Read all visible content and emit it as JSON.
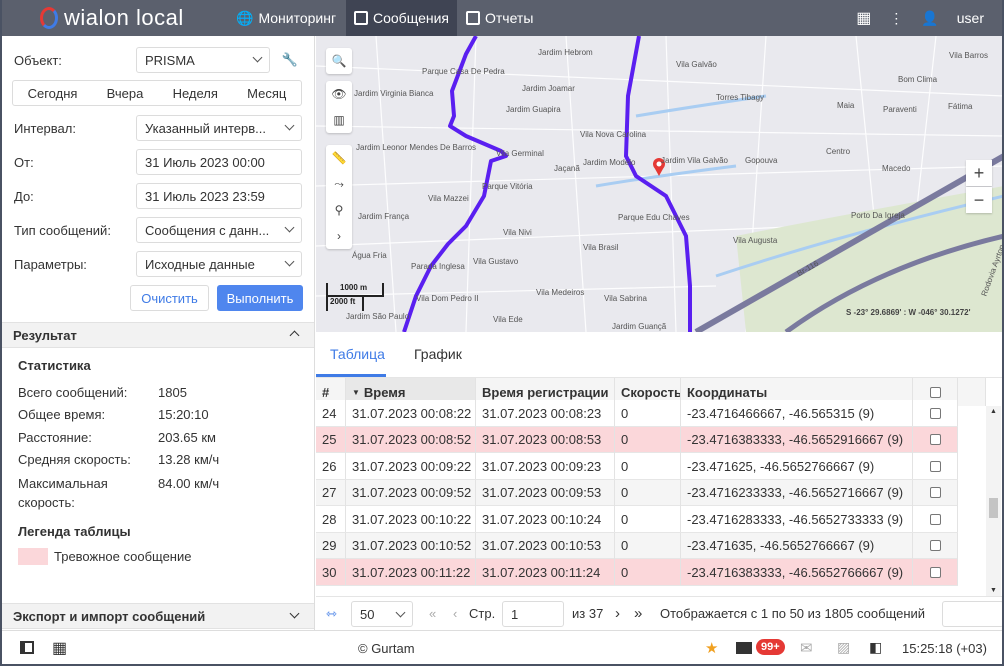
{
  "app": {
    "logo": "wialon local",
    "nav": [
      "Мониторинг",
      "Сообщения",
      "Отчеты"
    ],
    "active_nav": "Сообщения",
    "user": "user"
  },
  "form": {
    "object_label": "Объект:",
    "object_value": "PRISMA",
    "quick": [
      "Сегодня",
      "Вчера",
      "Неделя",
      "Месяц"
    ],
    "interval_label": "Интервал:",
    "interval_value": "Указанный интерв...",
    "from_label": "От:",
    "from_value": "31 Июль 2023 00:00",
    "to_label": "До:",
    "to_value": "31 Июль 2023 23:59",
    "type_label": "Тип сообщений:",
    "type_value": "Сообщения с данн...",
    "params_label": "Параметры:",
    "params_value": "Исходные данные",
    "clear": "Очистить",
    "execute": "Выполнить"
  },
  "result": {
    "title": "Результат",
    "stats_title": "Статистика",
    "stats": [
      {
        "label": "Всего сообщений:",
        "value": "1805"
      },
      {
        "label": "Общее время:",
        "value": "15:20:10"
      },
      {
        "label": "Расстояние:",
        "value": "203.65 км"
      },
      {
        "label": "Средняя скорость:",
        "value": "13.28 км/ч"
      },
      {
        "label": "Максимальная скорость:",
        "value": "84.00 км/ч"
      }
    ],
    "legend_title": "Легенда таблицы",
    "legend_alarm": "Тревожное сообщение",
    "export": "Экспорт и импорт сообщений"
  },
  "map": {
    "labels": [
      "Jardim Hebrom",
      "Parque Casa De Pedra",
      "Jardim Joamar",
      "Jardim Virginia Bianca",
      "Jardim Guapira",
      "Vila Nova Carolina",
      "Jardim Leonor Mendes De Barros",
      "Vila Germinal",
      "Jardim Modelo",
      "Jaçanã",
      "Parque Vitória",
      "Vila Mazzei",
      "Jardim França",
      "Parque Edu Chaves",
      "Vila Nivi",
      "Vila Brasil",
      "Água Fria",
      "Vila Gustavo",
      "Parada Inglesa",
      "Vila Medeiros",
      "Vila Dom Pedro II",
      "Vila Sabrina",
      "Jardim São Paulo",
      "Vila Ede",
      "Jardim Guançã",
      "Vila Galvão",
      "Vila Barros",
      "Bom Clima",
      "Torres Tibagy",
      "Maia",
      "Paraventi",
      "Fátima",
      "Jardim Vila Galvão",
      "Gopouva",
      "Centro",
      "Macedo",
      "Porto Da Igreja",
      "Vila Augusta",
      "Br-116",
      "Rodovia Ayrton"
    ],
    "scale_m": "1000 m",
    "scale_ft": "2000 ft",
    "coords": "S -23° 29.6869' : W -046° 30.1272'",
    "route_color": "#5a1ff0"
  },
  "tabs": [
    "Таблица",
    "График"
  ],
  "table": {
    "headers": [
      "#",
      "Время",
      "Время регистрации",
      "Скорость",
      "Координаты"
    ],
    "rows": [
      {
        "n": "24",
        "time": "31.07.2023 00:08:22",
        "reg": "31.07.2023 00:08:23",
        "speed": "0",
        "coords": "-23.4716466667, -46.565315 (9)",
        "alarm": false
      },
      {
        "n": "25",
        "time": "31.07.2023 00:08:52",
        "reg": "31.07.2023 00:08:53",
        "speed": "0",
        "coords": "-23.4716383333, -46.5652916667 (9)",
        "alarm": true
      },
      {
        "n": "26",
        "time": "31.07.2023 00:09:22",
        "reg": "31.07.2023 00:09:23",
        "speed": "0",
        "coords": "-23.471625, -46.5652766667 (9)",
        "alarm": false
      },
      {
        "n": "27",
        "time": "31.07.2023 00:09:52",
        "reg": "31.07.2023 00:09:53",
        "speed": "0",
        "coords": "-23.4716233333, -46.5652716667 (9)",
        "alarm": false
      },
      {
        "n": "28",
        "time": "31.07.2023 00:10:22",
        "reg": "31.07.2023 00:10:24",
        "speed": "0",
        "coords": "-23.4716283333, -46.5652733333 (9)",
        "alarm": false
      },
      {
        "n": "29",
        "time": "31.07.2023 00:10:52",
        "reg": "31.07.2023 00:10:53",
        "speed": "0",
        "coords": "-23.471635, -46.5652766667 (9)",
        "alarm": false
      },
      {
        "n": "30",
        "time": "31.07.2023 00:11:22",
        "reg": "31.07.2023 00:11:24",
        "speed": "0",
        "coords": "-23.4716383333, -46.5652766667 (9)",
        "alarm": true
      }
    ]
  },
  "pager": {
    "per_page": "50",
    "page_label": "Стр.",
    "page": "1",
    "of": "из 37",
    "summary": "Отображается с 1 по 50 из 1805 сообщений"
  },
  "footer": {
    "copyright": "© Gurtam",
    "badge": "99+",
    "time": "15:25:18 (+03)"
  },
  "colors": {
    "accent": "#3f7be6",
    "alarm_row": "#fbd7da",
    "topbar": "#5b606d"
  }
}
